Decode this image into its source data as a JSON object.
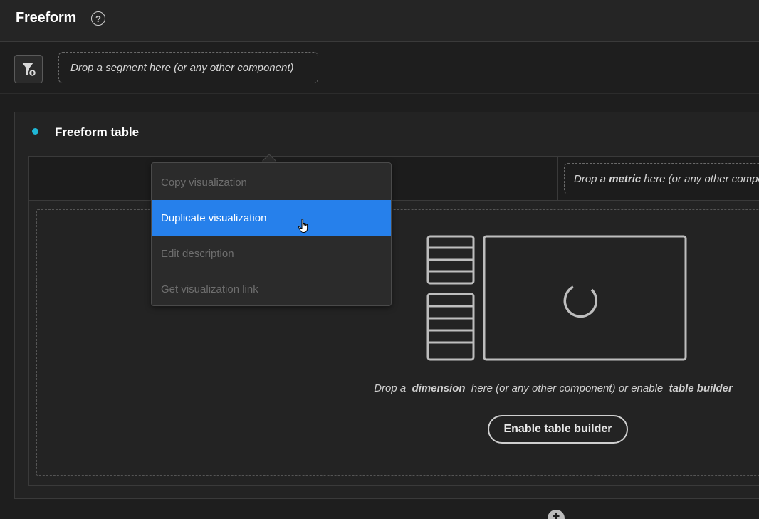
{
  "app": {
    "title": "Freeform",
    "help_icon": "?"
  },
  "segment_bar": {
    "filter_icon": "filter-add-icon",
    "drop_placeholder": "Drop a segment here (or any other component)"
  },
  "panel": {
    "title": "Freeform table",
    "accent_color": "#1fb7d6"
  },
  "table": {
    "metric_drop_prefix": "Drop a ",
    "metric_drop_bold": "metric",
    "metric_drop_suffix": " here (or any other component)",
    "dimension_text_prefix": "Drop a ",
    "dimension_text_bold1": "dimension",
    "dimension_text_middle": " here (or any other component) or enable ",
    "dimension_text_bold2": "table builder",
    "enable_button": "Enable table builder"
  },
  "context_menu": {
    "items": [
      {
        "label": "Copy visualization",
        "state": "disabled"
      },
      {
        "label": "Duplicate visualization",
        "state": "highlighted"
      },
      {
        "label": "Edit description",
        "state": "disabled"
      },
      {
        "label": "Get visualization link",
        "state": "disabled"
      }
    ],
    "highlight_color": "#2680eb"
  }
}
